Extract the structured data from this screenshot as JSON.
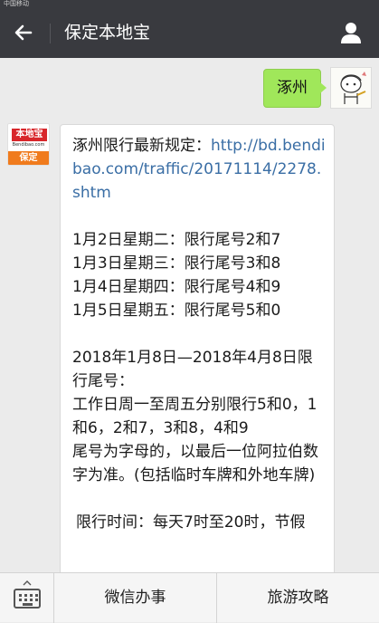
{
  "status_bar": {
    "carrier": "中国移动"
  },
  "header": {
    "title": "保定本地宝"
  },
  "chat": {
    "outgoing": {
      "text": "涿州"
    },
    "bot_logo": {
      "top": "本地宝",
      "mid": "Bendibao.com",
      "bottom": "保定"
    },
    "incoming": {
      "intro": "涿州限行最新规定：",
      "link": "http://bd.bendibao.com/traffic/20171114/2278.shtm",
      "lines": [
        "1月2日星期二：限行尾号2和7",
        "1月3日星期三：限行尾号3和8",
        "1月4日星期四：限行尾号4和9",
        "1月5日星期五：限行尾号5和0"
      ],
      "period_title": "2018年1月8日—2018年4月8日限行尾号：",
      "period_rule": "工作日周一至周五分别限行5和0，1和6，2和7，3和8，4和9",
      "note": "尾号为字母的，以最后一位阿拉伯数字为准。(包括临时车牌和外地车牌)",
      "time": "限行时间：每天7时至20时，节假"
    }
  },
  "bottom_menu": {
    "item1": "微信办事",
    "item2": "旅游攻略"
  },
  "colors": {
    "header_bg": "#393a3f",
    "chat_bg": "#ebebeb",
    "out_bubble": "#a0e75a",
    "link": "#3a6ea5"
  }
}
